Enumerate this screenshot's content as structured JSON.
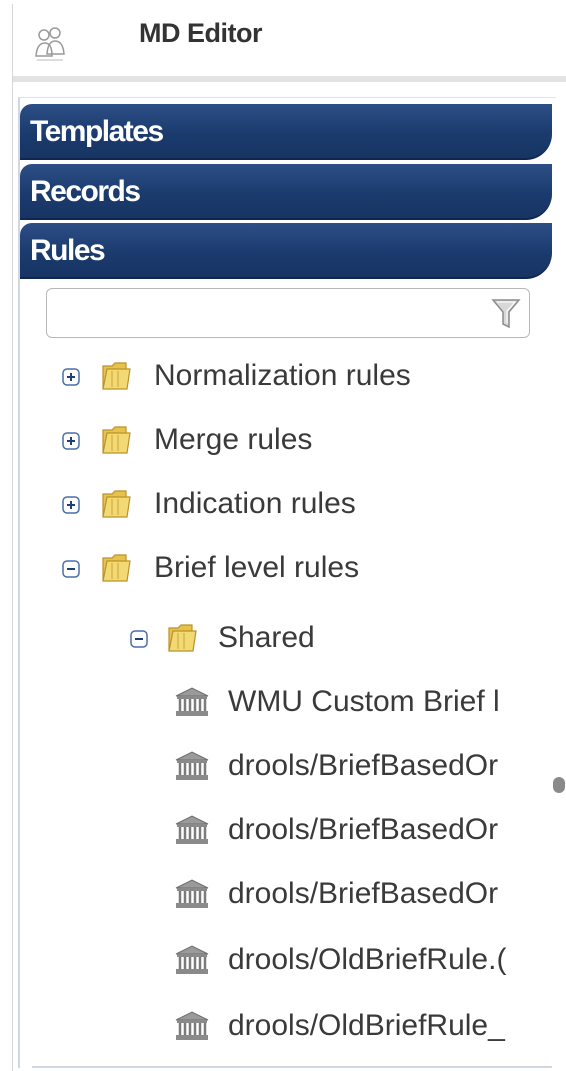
{
  "app": {
    "title": "MD Editor"
  },
  "accordion": {
    "sections": [
      {
        "label": "Templates"
      },
      {
        "label": "Records"
      },
      {
        "label": "Rules"
      }
    ]
  },
  "filter": {
    "value": "",
    "placeholder": ""
  },
  "tree": {
    "nodes": [
      {
        "label": "Normalization rules",
        "state": "collapsed"
      },
      {
        "label": "Merge rules",
        "state": "collapsed"
      },
      {
        "label": "Indication rules",
        "state": "collapsed"
      },
      {
        "label": "Brief level rules",
        "state": "expanded"
      }
    ],
    "shared": {
      "label": "Shared",
      "state": "expanded"
    },
    "leaves": [
      {
        "label": "WMU Custom Brief l"
      },
      {
        "label": "drools/BriefBasedOr"
      },
      {
        "label": "drools/BriefBasedOr"
      },
      {
        "label": "drools/BriefBasedOr"
      },
      {
        "label": "drools/OldBriefRule.("
      },
      {
        "label": "drools/OldBriefRule_"
      }
    ]
  },
  "colors": {
    "accordion_header": "#1b3b6e",
    "folder": "#e8c34a",
    "text": "#3a3a3a"
  }
}
